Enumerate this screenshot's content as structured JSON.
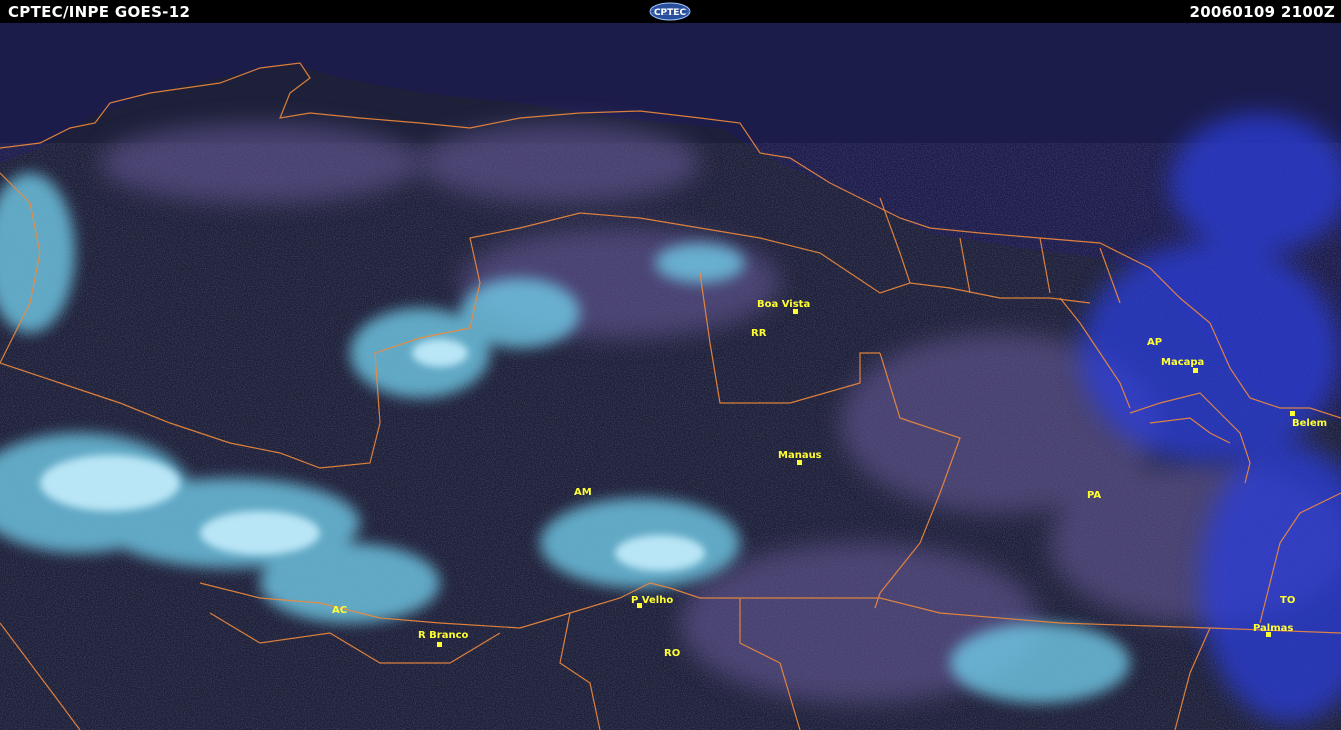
{
  "header": {
    "title": "CPTEC/INPE GOES-12",
    "logo_text": "CPTEC",
    "timestamp": "20060109  2100Z"
  },
  "colors": {
    "ocean": "#1c1c4a",
    "land": "#1d2038",
    "cloud_low": "#6b5d9e",
    "cloud_high": "#6fc9e6",
    "cloud_bright": "#c9f1ff",
    "convective_blue": "#2b3cd9",
    "borders": "#f08a3c",
    "labels": "#ffff33"
  },
  "map": {
    "cities": [
      "Boa Vista",
      "Macapa",
      "Belem",
      "Manaus",
      "P Velho",
      "R Branco",
      "Palmas"
    ],
    "states": [
      "RR",
      "AP",
      "AM",
      "PA",
      "AC",
      "RO",
      "TO"
    ]
  }
}
